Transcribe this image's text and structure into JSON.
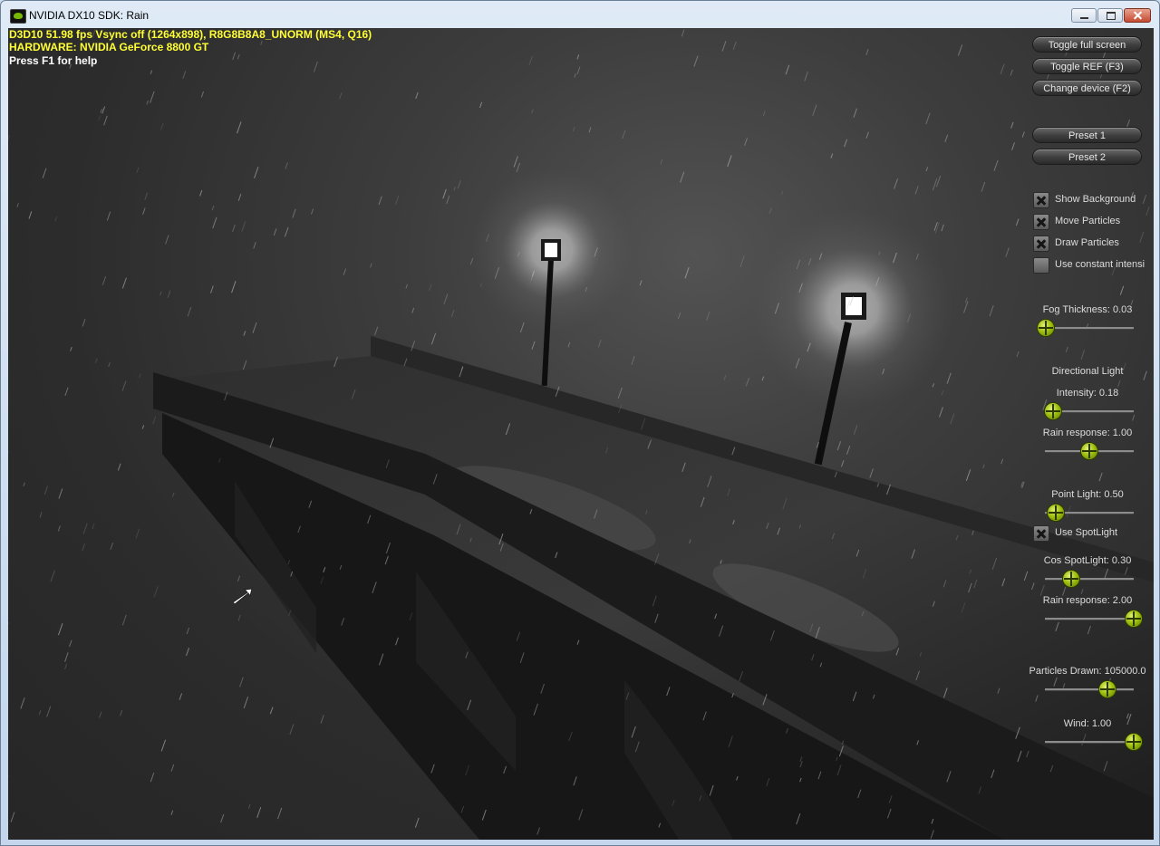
{
  "window": {
    "title": "NVIDIA DX10 SDK: Rain"
  },
  "hud": {
    "stats": "D3D10 51.98 fps Vsync off (1264x898), R8G8B8A8_UNORM (MS4, Q16)",
    "hardware": "HARDWARE: NVIDIA GeForce 8800 GT",
    "help": "Press F1 for help"
  },
  "buttons": {
    "fullscreen": "Toggle full screen",
    "ref": "Toggle REF (F3)",
    "device": "Change device (F2)",
    "preset1": "Preset 1",
    "preset2": "Preset 2"
  },
  "checkboxes": [
    {
      "label": "Show Background",
      "checked": true
    },
    {
      "label": "Move Particles",
      "checked": true
    },
    {
      "label": "Draw Particles",
      "checked": true
    },
    {
      "label": "Use constant intensi",
      "checked": false
    }
  ],
  "fog": {
    "label": "Fog Thickness: 0.03",
    "value": 0.03,
    "min": 0,
    "max": 2
  },
  "directional": {
    "heading": "Directional Light",
    "intensity": {
      "label": "Intensity: 0.18",
      "value": 0.18,
      "min": 0,
      "max": 2
    },
    "rain_response": {
      "label": "Rain response: 1.00",
      "value": 1.0,
      "min": 0,
      "max": 2
    }
  },
  "point": {
    "label": "Point Light: 0.50",
    "value": 0.5,
    "min": 0,
    "max": 4,
    "use_spotlight": {
      "label": "Use SpotLight",
      "checked": true
    },
    "cos_spotlight": {
      "label": "Cos SpotLight: 0.30",
      "value": 0.3,
      "min": 0,
      "max": 1
    },
    "rain_response": {
      "label": "Rain response: 2.00",
      "value": 2.0,
      "min": 0,
      "max": 2
    }
  },
  "particles": {
    "label": "Particles Drawn: 105000.0",
    "value": 105000,
    "min": 0,
    "max": 150000
  },
  "wind": {
    "label": "Wind: 1.00",
    "value": 1.0,
    "min": 0,
    "max": 1
  }
}
